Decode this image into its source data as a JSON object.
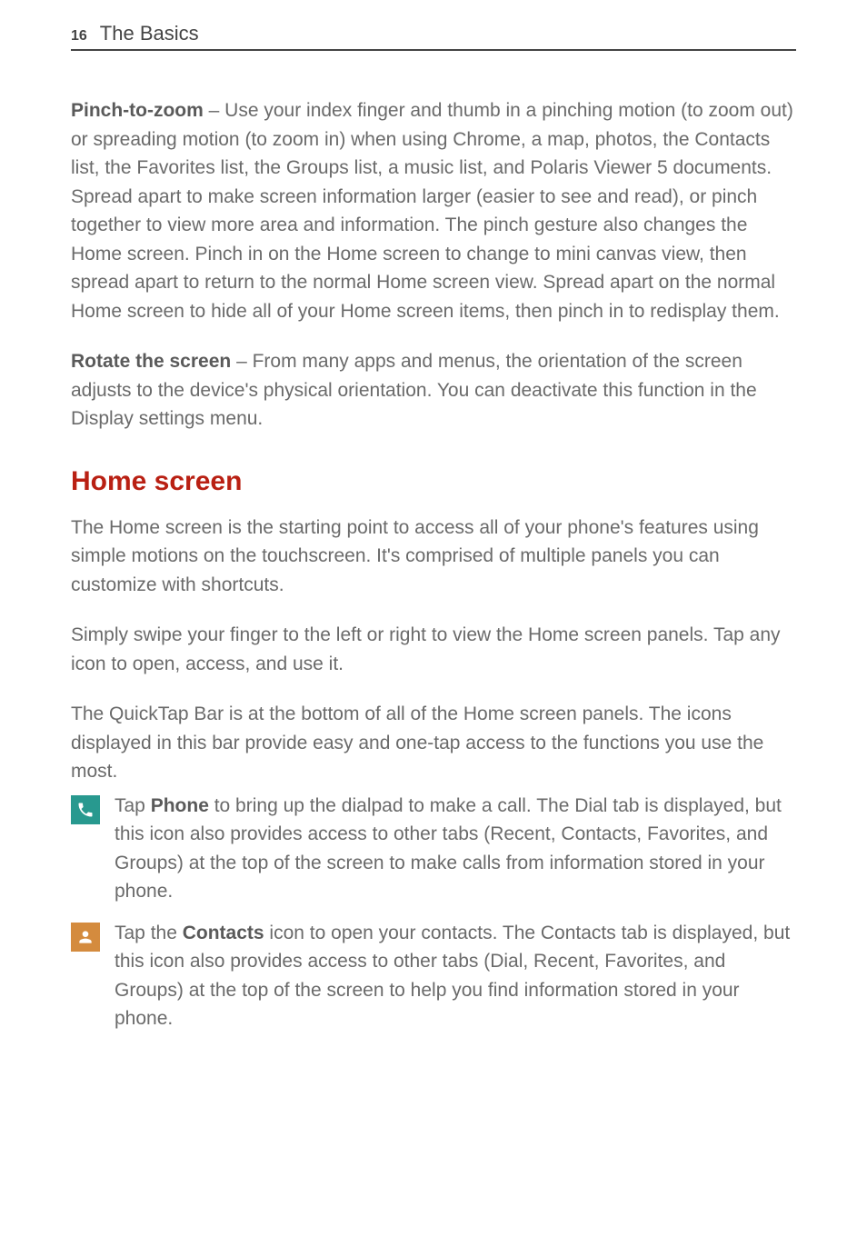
{
  "header": {
    "page_number": "16",
    "chapter_title": "The Basics"
  },
  "paragraphs": {
    "pinch_bold": "Pinch-to-zoom",
    "pinch_text": " – Use your index finger and thumb in a pinching motion (to zoom out) or spreading motion (to zoom in) when using Chrome, a map, photos, the Contacts list, the Favorites list, the Groups list, a music list, and Polaris Viewer 5 documents. Spread apart to make screen information larger (easier to see and read), or pinch together to view more area and information. The pinch gesture also changes the Home screen. Pinch in on the Home screen to change to mini canvas view, then spread apart to return to the normal Home screen view. Spread apart on the normal Home screen to hide all of your Home screen items, then pinch in to redisplay them.",
    "rotate_bold": "Rotate the screen",
    "rotate_text": " – From many apps and menus, the orientation of the screen adjusts to the device's physical orientation. You can deactivate this function in the Display settings menu."
  },
  "section": {
    "heading": "Home screen",
    "p1": "The Home screen is the starting point to access all of your phone's features using simple motions on the touchscreen. It's comprised of multiple panels you can customize with shortcuts.",
    "p2": "Simply swipe your finger to the left or right to view the Home screen panels. Tap any icon to open, access, and use it.",
    "p3": "The QuickTap Bar is at the bottom of all of the Home screen panels. The icons displayed in this bar provide easy and one-tap access to the functions you use the most."
  },
  "quicktap": {
    "phone": {
      "pre": "Tap ",
      "bold": "Phone",
      "post": " to bring up the dialpad to make a call. The Dial tab is displayed, but this icon also provides access to other tabs (Recent, Contacts, Favorites, and Groups) at the top of the screen to make calls from information stored in your phone."
    },
    "contacts": {
      "pre": "Tap the ",
      "bold": "Contacts",
      "post": " icon to open your contacts. The Contacts tab is displayed, but this icon also provides access to other tabs (Dial, Recent, Favorites, and Groups) at the top of the screen to help you find information stored in your phone."
    }
  }
}
